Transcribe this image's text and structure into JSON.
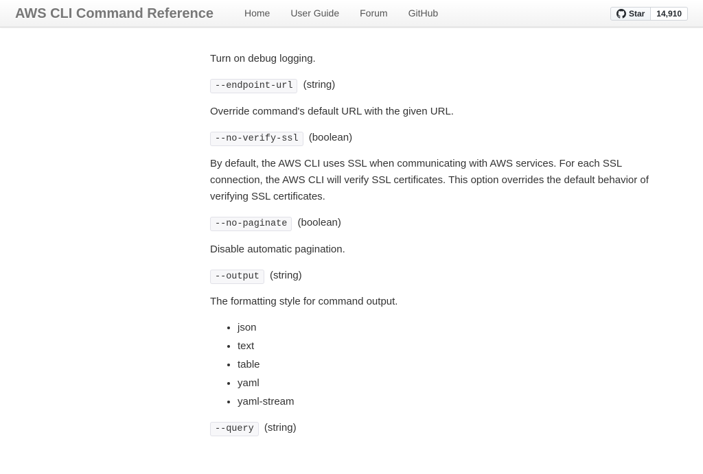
{
  "header": {
    "brand": "AWS CLI Command Reference",
    "nav": [
      "Home",
      "User Guide",
      "Forum",
      "GitHub"
    ],
    "star_label": "Star",
    "star_count": "14,910"
  },
  "options": [
    {
      "flag": "",
      "type": "",
      "desc": "Turn on debug logging."
    },
    {
      "flag": "--endpoint-url",
      "type": "(string)",
      "desc": "Override command's default URL with the given URL."
    },
    {
      "flag": "--no-verify-ssl",
      "type": "(boolean)",
      "desc": "By default, the AWS CLI uses SSL when communicating with AWS services. For each SSL connection, the AWS CLI will verify SSL certificates. This option overrides the default behavior of verifying SSL certificates."
    },
    {
      "flag": "--no-paginate",
      "type": "(boolean)",
      "desc": "Disable automatic pagination."
    },
    {
      "flag": "--output",
      "type": "(string)",
      "desc": "The formatting style for command output.",
      "list": [
        "json",
        "text",
        "table",
        "yaml",
        "yaml-stream"
      ]
    },
    {
      "flag": "--query",
      "type": "(string)",
      "desc": ""
    }
  ]
}
